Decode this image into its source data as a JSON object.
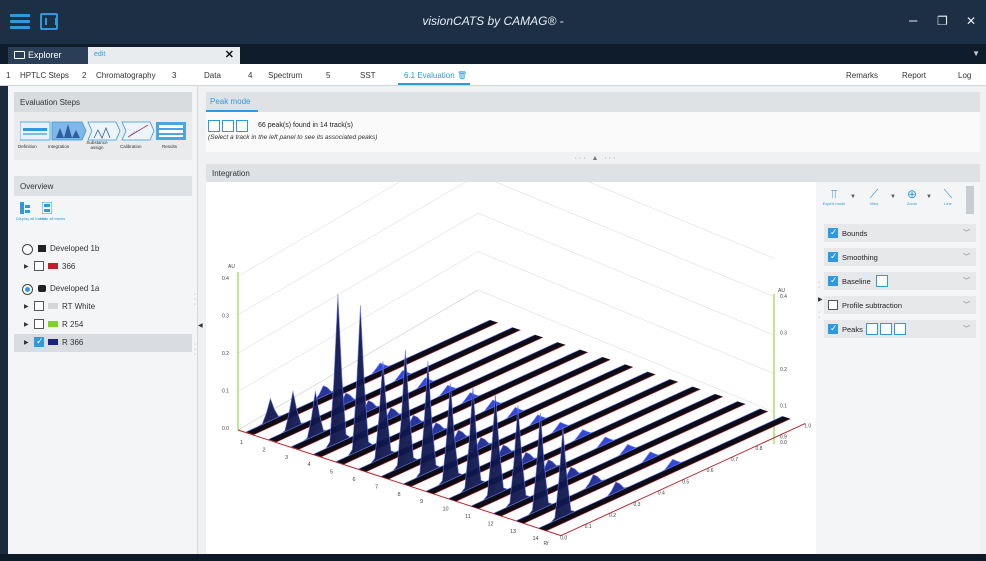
{
  "titlebar": {
    "title": "visionCATS by CAMAG® -",
    "minimize": "–",
    "restore": "❐",
    "close": "✕"
  },
  "tabs": {
    "explorer": "Explorer",
    "document": "edit",
    "document_close": "✕",
    "overflow": "▼"
  },
  "workflow": {
    "steps": [
      {
        "num": "1",
        "label": "HPTLC Steps"
      },
      {
        "num": "2",
        "label": "Chromatography"
      },
      {
        "num": "3",
        "label": "Data"
      },
      {
        "num": "4",
        "label": "Spectrum"
      },
      {
        "num": "5",
        "label": "SST"
      },
      {
        "num": "",
        "label": "6.1 Evaluation"
      }
    ],
    "right": [
      "Remarks",
      "Report",
      "Log"
    ]
  },
  "left_panel": {
    "eval_title": "Evaluation Steps",
    "step_labels": [
      "Definition",
      "Integration",
      "Substance assign",
      "Calibration",
      "Results"
    ],
    "overview_title": "Overview",
    "ov_icons": [
      "Display all tracks",
      "Hide all tracks"
    ],
    "tracks": [
      {
        "label": "Developed 1b",
        "kind": "group",
        "selected": false
      },
      {
        "label": "366",
        "kind": "item",
        "checked": false,
        "color": "#c0202a"
      },
      {
        "label": "Developed 1a",
        "kind": "group",
        "selected": true
      },
      {
        "label": "RT White",
        "kind": "item",
        "checked": false,
        "color": "#d6d6d6"
      },
      {
        "label": "R 254",
        "kind": "item",
        "checked": false,
        "color": "#7ed321"
      },
      {
        "label": "R 366",
        "kind": "item",
        "checked": true,
        "color": "#1b1f8a"
      }
    ]
  },
  "peak_mode": {
    "tab": "Peak mode",
    "summary": "66 peak(s) found in 14 track(s)",
    "note": "(Select a track in the left panel to see its associated peaks)"
  },
  "integration": {
    "title": "Integration",
    "tools": [
      {
        "label": "Expert mode",
        "icon": "expert-mode-icon"
      },
      {
        "label": "View",
        "icon": "view-icon"
      },
      {
        "label": "Zoom",
        "icon": "zoom-icon"
      },
      {
        "label": "Line",
        "icon": "line-icon"
      }
    ],
    "options": [
      {
        "label": "Bounds",
        "checked": true
      },
      {
        "label": "Smoothing",
        "checked": true
      },
      {
        "label": "Baseline",
        "checked": true
      },
      {
        "label": "Profile subtraction",
        "checked": false
      },
      {
        "label": "Peaks",
        "checked": true
      }
    ]
  },
  "chart_data": {
    "type": "area",
    "title": "",
    "y_left_label": "AU",
    "y_right_label": "AU",
    "y_left_ticks": [
      "0.0",
      "0.1",
      "0.2",
      "0.3",
      "0.4"
    ],
    "y_right_ticks": [
      "0.0",
      "0.1",
      "0.2",
      "0.3",
      "0.4"
    ],
    "track_ticks": [
      "1",
      "2",
      "3",
      "4",
      "5",
      "6",
      "7",
      "8",
      "9",
      "10",
      "11",
      "12",
      "13",
      "14"
    ],
    "rf_label": "Rf",
    "rf_ticks": [
      "0.0",
      "0.1",
      "0.2",
      "0.3",
      "0.4",
      "0.5",
      "0.6",
      "0.7",
      "0.8",
      "0.9",
      "1.0"
    ],
    "main_peak_rf": 0.1,
    "track_peak_heights": [
      0.06,
      0.1,
      0.12,
      0.4,
      0.39,
      0.26,
      0.31,
      0.3,
      0.26,
      0.27,
      0.27,
      0.26,
      0.26,
      0.24
    ],
    "secondary_peak_height": 0.03
  }
}
